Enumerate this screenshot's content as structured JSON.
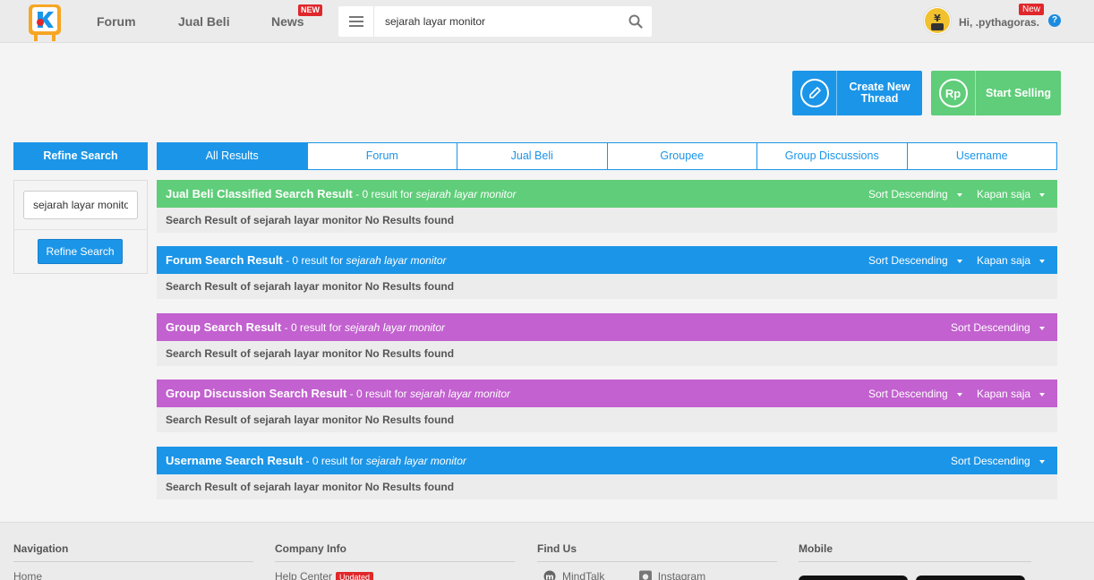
{
  "header": {
    "nav": [
      {
        "label": "Forum"
      },
      {
        "label": "Jual Beli"
      },
      {
        "label": "News",
        "badge": "NEW"
      }
    ],
    "search": {
      "value": "sejarah layar monitor",
      "placeholder": ""
    },
    "user": {
      "greeting": "Hi, .pythagoras.",
      "badge": "New"
    },
    "help_label": "?"
  },
  "actions": {
    "create_thread": "Create New Thread",
    "start_selling": "Start Selling",
    "rp_label": "Rp"
  },
  "sidebar": {
    "header": "Refine Search",
    "input_value": "sejarah layar monitor",
    "button_label": "Refine Search"
  },
  "tabs": [
    "All Results",
    "Forum",
    "Jual Beli",
    "Groupee",
    "Group Discussions",
    "Username"
  ],
  "sections": [
    {
      "title": "Jual Beli Classified Search Result",
      "meta": " - 0 result for ",
      "query": "sejarah layar monitor",
      "sort": "Sort Descending",
      "time": "Kapan saja",
      "body": "Search Result of sejarah layar monitor No Results found"
    },
    {
      "title": "Forum Search Result",
      "meta": " - 0 result for ",
      "query": "sejarah layar monitor",
      "sort": "Sort Descending",
      "time": "Kapan saja",
      "body": "Search Result of sejarah layar monitor No Results found"
    },
    {
      "title": "Group Search Result",
      "meta": " - 0 result for ",
      "query": "sejarah layar monitor",
      "sort": "Sort Descending",
      "body": "Search Result of sejarah layar monitor No Results found"
    },
    {
      "title": "Group Discussion Search Result",
      "meta": " - 0 result for ",
      "query": "sejarah layar monitor",
      "sort": "Sort Descending",
      "time": "Kapan saja",
      "body": "Search Result of sejarah layar monitor No Results found"
    },
    {
      "title": "Username Search Result",
      "meta": " - 0 result for ",
      "query": "sejarah layar monitor",
      "sort": "Sort Descending",
      "body": "Search Result of sejarah layar monitor No Results found"
    }
  ],
  "footer": {
    "navigation": {
      "heading": "Navigation",
      "first_link": "Home"
    },
    "company": {
      "heading": "Company Info",
      "first_link": "Help Center",
      "badge": "Updated"
    },
    "findus": {
      "heading": "Find Us",
      "links": [
        "MindTalk",
        "Instagram"
      ]
    },
    "mobile": {
      "heading": "Mobile"
    }
  },
  "colors": {
    "primary_blue": "#1b95e8",
    "green": "#5fcd79",
    "purple": "#c261cf",
    "badge_red": "#e0272b"
  }
}
